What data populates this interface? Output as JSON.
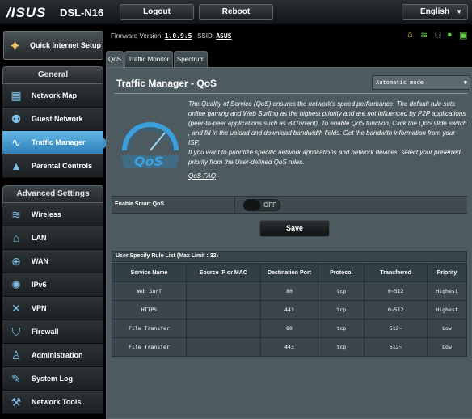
{
  "header": {
    "brand": "/ISUS",
    "model": "DSL-N16",
    "logout_label": "Logout",
    "reboot_label": "Reboot",
    "language": "English"
  },
  "quick_setup": {
    "label": "Quick Internet Setup",
    "icon": "wand-icon"
  },
  "firmware": {
    "label": "Firmware Version:",
    "version": "1.0.9.5",
    "ssid_label": "SSID:",
    "ssid": "ASUS"
  },
  "sidebar": {
    "general_title": "General",
    "general_items": [
      {
        "label": "Network Map",
        "icon": "network-map-icon"
      },
      {
        "label": "Guest Network",
        "icon": "guest-network-icon"
      },
      {
        "label": "Traffic Manager",
        "icon": "traffic-manager-icon",
        "active": true
      },
      {
        "label": "Parental Controls",
        "icon": "lock-icon"
      }
    ],
    "advanced_title": "Advanced Settings",
    "advanced_items": [
      {
        "label": "Wireless",
        "icon": "wifi-icon"
      },
      {
        "label": "LAN",
        "icon": "home-icon"
      },
      {
        "label": "WAN",
        "icon": "globe-icon"
      },
      {
        "label": "IPv6",
        "icon": "ipv6-icon"
      },
      {
        "label": "VPN",
        "icon": "vpn-icon"
      },
      {
        "label": "Firewall",
        "icon": "shield-icon"
      },
      {
        "label": "Administration",
        "icon": "person-icon"
      },
      {
        "label": "System Log",
        "icon": "log-icon"
      },
      {
        "label": "Network Tools",
        "icon": "tools-icon"
      }
    ]
  },
  "tabs": [
    {
      "label": "QoS",
      "active": true
    },
    {
      "label": "Traffic Monitor"
    },
    {
      "label": "Spectrum"
    }
  ],
  "main": {
    "title": "Traffic Manager - QoS",
    "mode": "Automatic mode",
    "description_1": "The Quality of Service (QoS) ensures the network's speed performance. The default rule sets online gaming and Web Surfing as the highest priority and are not influenced by P2P applications (peer-to-peer applications such as BitTorrent). To enable QoS function, Click the QoS slide switch , and fill in the upload and download bandwidth fields. Get the bandwith information from your ISP.",
    "description_2": "If you want to prioritize specific network applications and network devices, select your preferred priority from the User-defined QoS rules.",
    "faq_link": "QoS FAQ",
    "smart_qos_label": "Enable Smart QoS",
    "toggle_state": "OFF",
    "save_label": "Save"
  },
  "rule_table": {
    "title": "User Specify Rule List (Max Limit : 32)",
    "columns": [
      "Service Name",
      "Source IP or MAC",
      "Destination Port",
      "Protocol",
      "Transferred",
      "Priority"
    ],
    "rows": [
      [
        "Web Surf",
        "",
        "80",
        "tcp",
        "0~512",
        "Highest"
      ],
      [
        "HTTPS",
        "",
        "443",
        "tcp",
        "0~512",
        "Highest"
      ],
      [
        "File Transfer",
        "",
        "80",
        "tcp",
        "512~",
        "Low"
      ],
      [
        "File Transfer",
        "",
        "443",
        "tcp",
        "512~",
        "Low"
      ]
    ]
  },
  "colors": {
    "accent": "#3d93c9",
    "panel": "#4d5a5f",
    "status_green": "#5fd13a",
    "status_yellow": "#f2d63a"
  },
  "status_icons": [
    "dsl-icon",
    "wifi-status-icon",
    "users-icon",
    "usb-icon",
    "app-icon"
  ]
}
